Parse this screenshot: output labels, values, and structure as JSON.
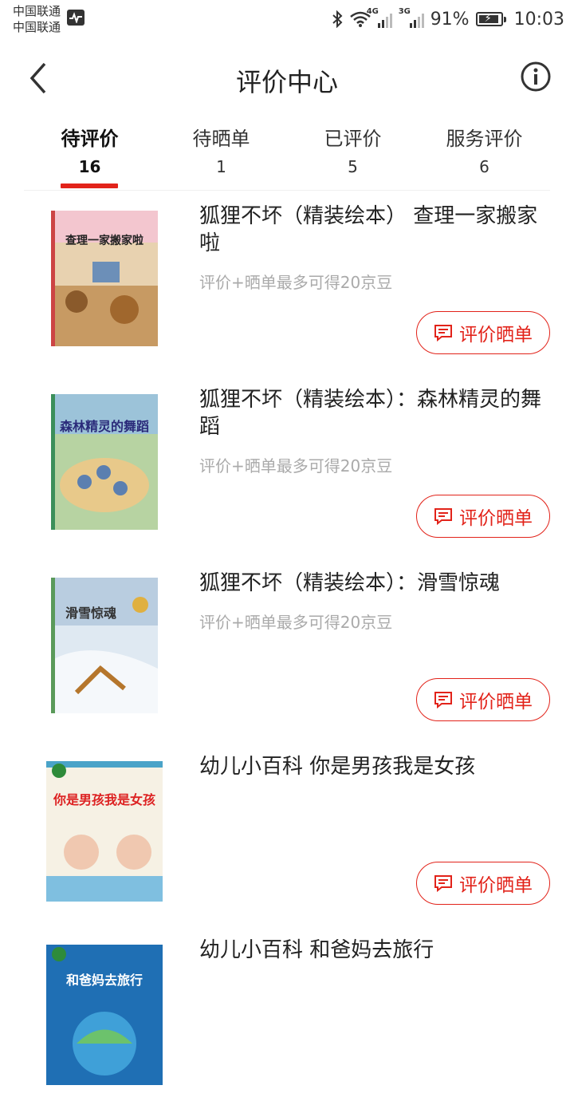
{
  "status_bar": {
    "carrier1": "中国联通",
    "carrier2": "中国联通",
    "net1": "4G",
    "net2": "3G",
    "battery": "91%",
    "battery_level": 0.91,
    "time": "10:03"
  },
  "nav": {
    "title": "评价中心"
  },
  "tabs": [
    {
      "label": "待评价",
      "count": "16"
    },
    {
      "label": "待晒单",
      "count": "1"
    },
    {
      "label": "已评价",
      "count": "5"
    },
    {
      "label": "服务评价",
      "count": "6"
    }
  ],
  "items": [
    {
      "title": "狐狸不坏（精装绘本） 查理一家搬家啦",
      "subtitle": "评价+晒单最多可得20京豆",
      "button": "评价晒单",
      "cover_text": "查理一家搬家啦"
    },
    {
      "title": "狐狸不坏（精装绘本）：森林精灵的舞蹈",
      "subtitle": "评价+晒单最多可得20京豆",
      "button": "评价晒单",
      "cover_text": "森林精灵的舞蹈"
    },
    {
      "title": "狐狸不坏（精装绘本）：滑雪惊魂",
      "subtitle": "评价+晒单最多可得20京豆",
      "button": "评价晒单",
      "cover_text": "滑雪惊魂"
    },
    {
      "title": "幼儿小百科 你是男孩我是女孩",
      "subtitle": "",
      "button": "评价晒单",
      "cover_text": "你是男孩我是女孩"
    },
    {
      "title": "幼儿小百科 和爸妈去旅行",
      "subtitle": "",
      "button": "",
      "cover_text": "和爸妈去旅行"
    }
  ],
  "colors": {
    "accent": "#e2231a"
  }
}
